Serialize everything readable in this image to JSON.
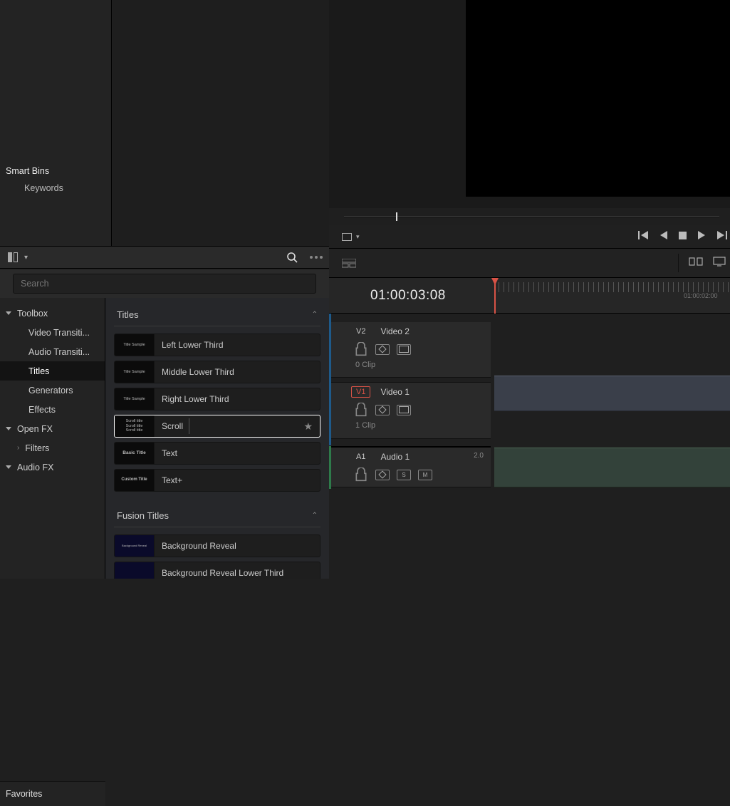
{
  "smart_bins": {
    "header": "Smart Bins",
    "keywords": "Keywords"
  },
  "search": {
    "placeholder": "Search"
  },
  "fx_tree": {
    "toolbox": "Toolbox",
    "video_trans": "Video Transiti...",
    "audio_trans": "Audio Transiti...",
    "titles": "Titles",
    "generators": "Generators",
    "effects": "Effects",
    "openfx": "Open FX",
    "filters": "Filters",
    "audiofx": "Audio FX",
    "favorites": "Favorites"
  },
  "titles_section": {
    "header": "Titles",
    "items": [
      {
        "thumb": "Title\nSample",
        "label": "Left Lower Third"
      },
      {
        "thumb": "Title\nSample",
        "label": "Middle Lower Third"
      },
      {
        "thumb": "Title\nSample",
        "label": "Right Lower Third"
      },
      {
        "thumb": "Scroll title\nScroll title\nScroll title",
        "label": "Scroll"
      },
      {
        "thumb": "Basic Title",
        "label": "Text"
      },
      {
        "thumb": "Custom Title",
        "label": "Text+"
      }
    ]
  },
  "fusion_section": {
    "header": "Fusion Titles",
    "items": [
      {
        "thumb": "Background Reveal",
        "label": "Background Reveal"
      },
      {
        "thumb": "",
        "label": "Background Reveal Lower Third"
      }
    ]
  },
  "timecode": "01:00:03:08",
  "ruler": {
    "label1": "01:00:02:00"
  },
  "tracks": {
    "v2": {
      "tag": "V2",
      "name": "Video 2",
      "clips": "0 Clip"
    },
    "v1": {
      "tag": "V1",
      "name": "Video 1",
      "clips": "1 Clip"
    },
    "a1": {
      "tag": "A1",
      "name": "Audio 1",
      "meter": "2.0",
      "s": "S",
      "m": "M"
    }
  }
}
